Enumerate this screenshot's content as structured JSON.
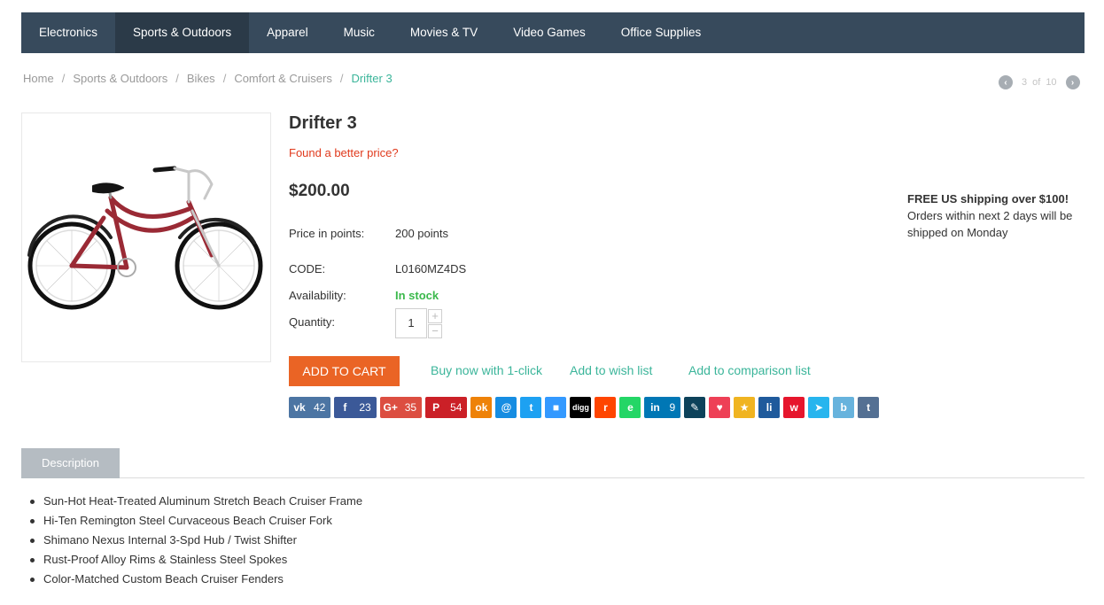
{
  "nav": {
    "items": [
      {
        "label": "Electronics"
      },
      {
        "label": "Sports & Outdoors",
        "active": true
      },
      {
        "label": "Apparel"
      },
      {
        "label": "Music"
      },
      {
        "label": "Movies & TV"
      },
      {
        "label": "Video Games"
      },
      {
        "label": "Office Supplies"
      }
    ]
  },
  "breadcrumb": {
    "items": [
      "Home",
      "Sports & Outdoors",
      "Bikes",
      "Comfort & Cruisers"
    ],
    "current": "Drifter 3"
  },
  "pager": {
    "current": "3",
    "of": "of",
    "total": "10",
    "prev_icon": "chevron-left-icon",
    "next_icon": "chevron-right-icon"
  },
  "product": {
    "title": "Drifter 3",
    "better_price": "Found a better price?",
    "price": "$200.00",
    "points_label": "Price in points:",
    "points_value": "200 points",
    "code_label": "CODE:",
    "code_value": "L0160MZ4DS",
    "availability_label": "Availability:",
    "availability_value": "In stock",
    "quantity_label": "Quantity:",
    "quantity_value": "1",
    "qty_plus": "+",
    "qty_minus": "−",
    "bike_color": "#9a2a35"
  },
  "actions": {
    "add_to_cart": "ADD TO CART",
    "buy_now": "Buy now with 1-click",
    "wishlist": "Add to wish list",
    "comparison": "Add to comparison list"
  },
  "shipping": {
    "head": "FREE US shipping over $100!",
    "text": "Orders within next 2 days will be shipped on Monday"
  },
  "share": [
    {
      "name": "vk",
      "glyph": "vk",
      "color": "#4c75a3",
      "count": "42"
    },
    {
      "name": "facebook",
      "glyph": "f",
      "color": "#3b5998",
      "count": "23"
    },
    {
      "name": "google-plus",
      "glyph": "G+",
      "color": "#dc4e41",
      "count": "35"
    },
    {
      "name": "pinterest",
      "glyph": "P",
      "color": "#cb2027",
      "count": "54"
    },
    {
      "name": "odnoklassniki",
      "glyph": "ok",
      "color": "#ee8208"
    },
    {
      "name": "moimir",
      "glyph": "@",
      "color": "#168de2"
    },
    {
      "name": "twitter",
      "glyph": "t",
      "color": "#1da1f2"
    },
    {
      "name": "delicious",
      "glyph": "■",
      "color": "#3399ff"
    },
    {
      "name": "digg",
      "glyph": "digg",
      "color": "#000000"
    },
    {
      "name": "reddit",
      "glyph": "r",
      "color": "#ff4500"
    },
    {
      "name": "evernote",
      "glyph": "e",
      "color": "#24d666"
    },
    {
      "name": "linkedin",
      "glyph": "in",
      "color": "#0077b5",
      "count": "9"
    },
    {
      "name": "livejournal",
      "glyph": "✎",
      "color": "#0d425a"
    },
    {
      "name": "pocket",
      "glyph": "♥",
      "color": "#ee4056"
    },
    {
      "name": "surfingbird",
      "glyph": "★",
      "color": "#f0b421"
    },
    {
      "name": "liveinternet",
      "glyph": "li",
      "color": "#1f5a9c"
    },
    {
      "name": "weibo",
      "glyph": "w",
      "color": "#e6162d"
    },
    {
      "name": "bookmark",
      "glyph": "➤",
      "color": "#27b5ee"
    },
    {
      "name": "blogger",
      "glyph": "b",
      "color": "#67b3dd"
    },
    {
      "name": "tumblr",
      "glyph": "t",
      "color": "#547093"
    }
  ],
  "tabs": {
    "description": "Description"
  },
  "description": [
    "Sun-Hot Heat-Treated Aluminum Stretch Beach Cruiser Frame",
    "Hi-Ten Remington Steel Curvaceous Beach Cruiser Fork",
    "Shimano Nexus Internal 3-Spd Hub / Twist Shifter",
    "Rust-Proof Alloy Rims & Stainless Steel Spokes",
    "Color-Matched Custom Beach Cruiser Fenders"
  ]
}
